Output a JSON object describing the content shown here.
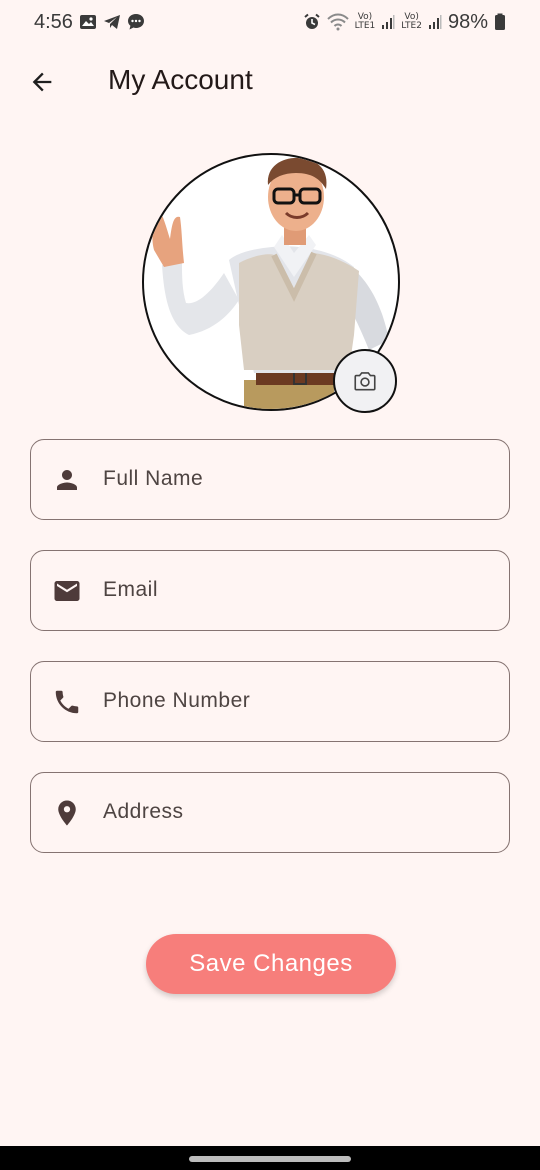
{
  "status_bar": {
    "time": "4:56",
    "battery": "98%",
    "sim1_top": "Vo)",
    "sim1_bottom": "LTE1",
    "sim2_top": "Vo)",
    "sim2_bottom": "LTE2",
    "left_icons": [
      "image-icon",
      "telegram-icon",
      "chat-icon"
    ],
    "right_icons": [
      "alarm-icon",
      "wifi-icon",
      "signal-icon",
      "battery-icon"
    ]
  },
  "app_bar": {
    "title": "My Account",
    "back_icon": "arrow-back-icon"
  },
  "avatar": {
    "camera_icon": "camera-icon"
  },
  "form": {
    "fields": [
      {
        "icon": "person-icon",
        "placeholder": "Full Name",
        "value": ""
      },
      {
        "icon": "email-icon",
        "placeholder": "Email",
        "value": ""
      },
      {
        "icon": "phone-icon",
        "placeholder": "Phone Number",
        "value": ""
      },
      {
        "icon": "location-pin-icon",
        "placeholder": "Address",
        "value": ""
      }
    ]
  },
  "save_button": {
    "label": "Save Changes"
  },
  "colors": {
    "background": "#FFF5F3",
    "accent": "#F77E7B",
    "icon": "#4E3B3A",
    "border": "#857371"
  }
}
